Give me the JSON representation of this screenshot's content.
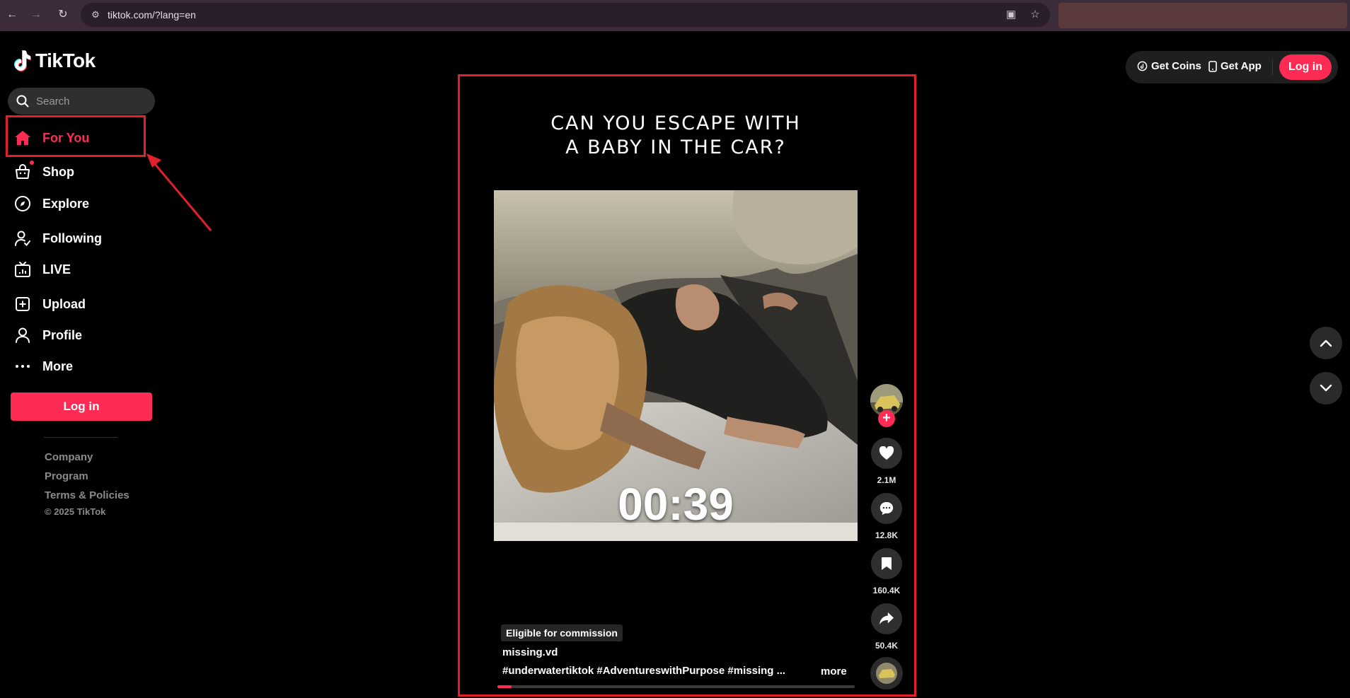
{
  "browser": {
    "url": "tiktok.com/?lang=en"
  },
  "brand": {
    "name": "TikTok",
    "accent": "#fe2c55"
  },
  "search": {
    "placeholder": "Search"
  },
  "sidebar": {
    "items": [
      {
        "label": "For You",
        "icon": "home-icon",
        "active": true
      },
      {
        "label": "Shop",
        "icon": "shop-bag-icon",
        "active": false
      },
      {
        "label": "Explore",
        "icon": "compass-icon",
        "active": false
      },
      {
        "label": "Following",
        "icon": "following-icon",
        "active": false
      },
      {
        "label": "LIVE",
        "icon": "live-tv-icon",
        "active": false
      },
      {
        "label": "Upload",
        "icon": "upload-plus-icon",
        "active": false
      },
      {
        "label": "Profile",
        "icon": "person-icon",
        "active": false
      },
      {
        "label": "More",
        "icon": "more-dots-icon",
        "active": false
      }
    ],
    "login_label": "Log in",
    "footer_links": [
      "Company",
      "Program",
      "Terms & Policies"
    ],
    "copyright": "© 2025 TikTok"
  },
  "header": {
    "get_coins": "Get Coins",
    "get_app": "Get App",
    "login_label": "Log in"
  },
  "video": {
    "headline_line1": "CAN YOU ESCAPE WITH",
    "headline_line2": "A BABY IN THE CAR?",
    "timer": "00:39",
    "badge": "Eligible for commission",
    "author": "missing.vd",
    "caption": "#underwatertiktok  #AdventureswithPurpose  #missing  ...",
    "more_label": "more",
    "progress": 0.04
  },
  "actions": {
    "likes": "2.1M",
    "comments": "12.8K",
    "saves": "160.4K",
    "shares": "50.4K"
  },
  "annotation_color": "#e0202a"
}
